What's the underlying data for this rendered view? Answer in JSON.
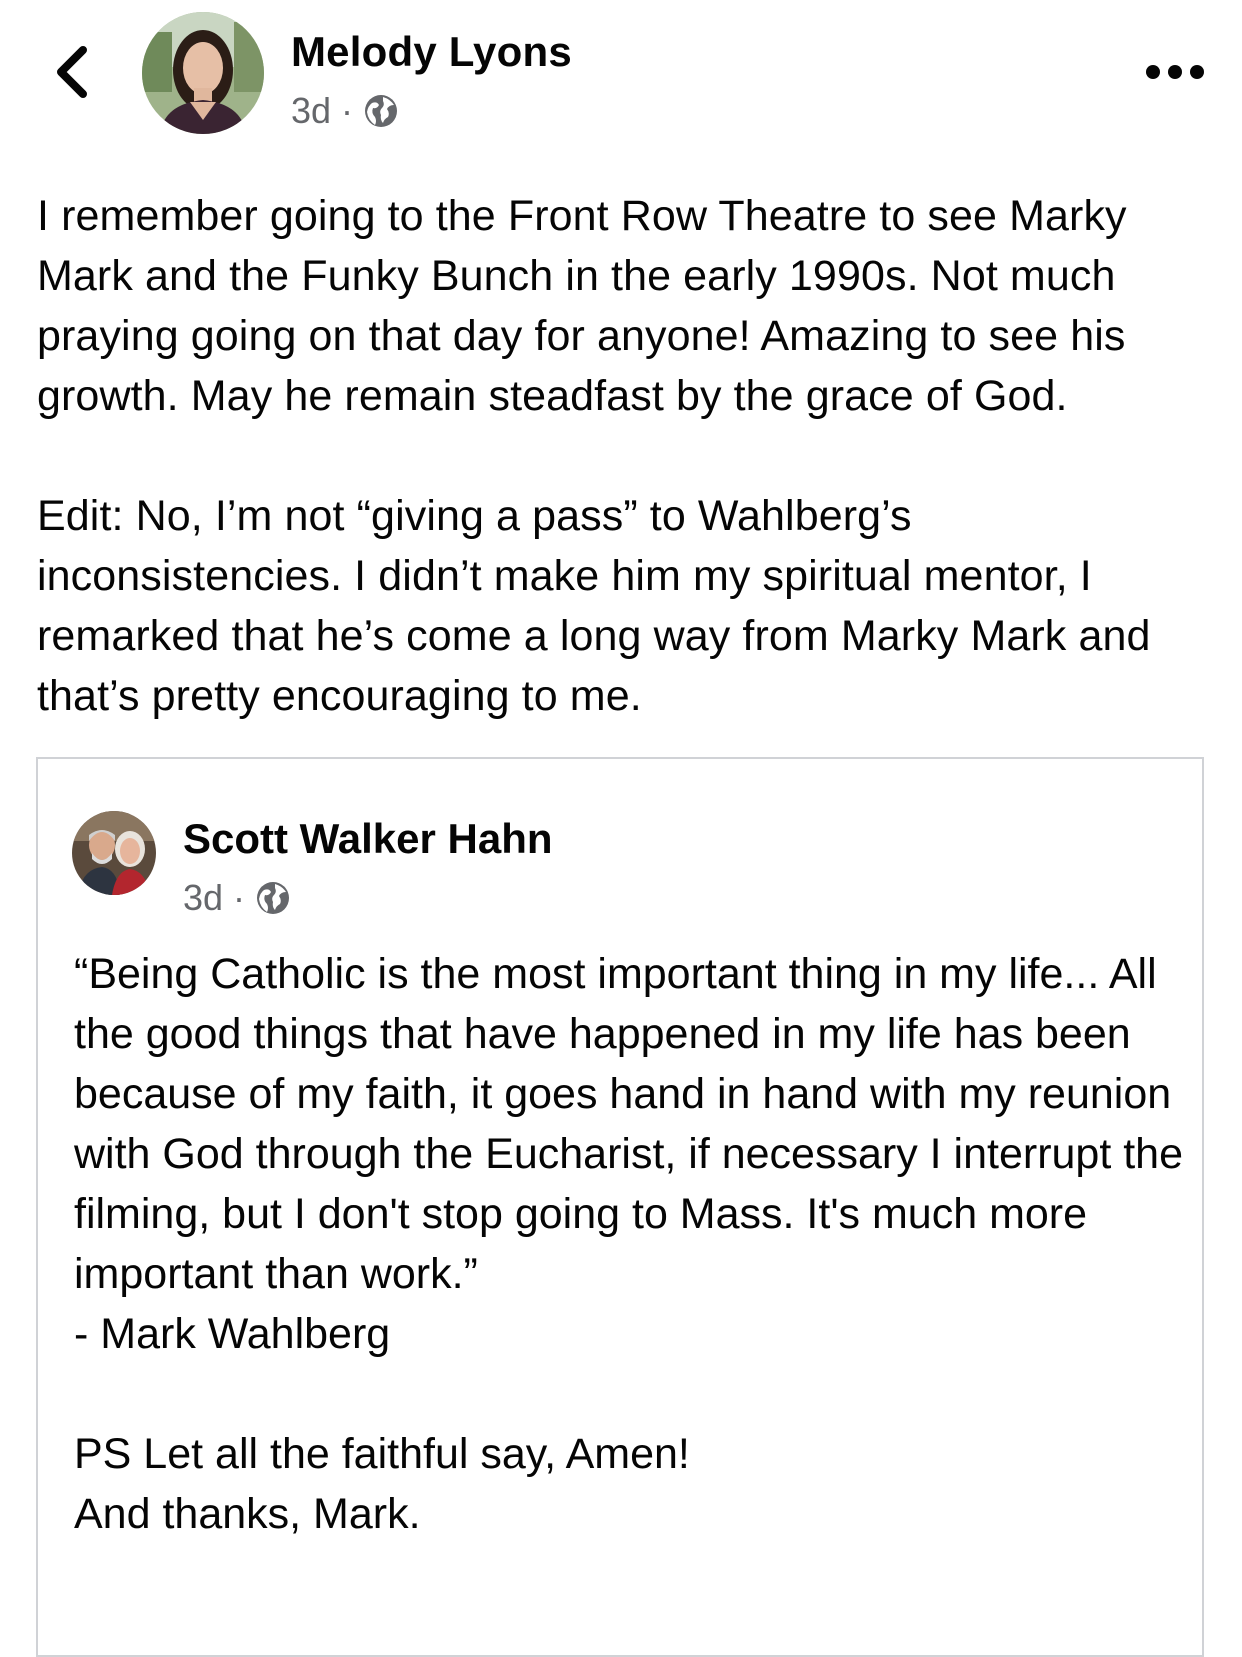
{
  "header": {
    "author_name": "Melody Lyons",
    "time": "3d",
    "separator": "·",
    "privacy_icon": "globe-icon",
    "back_icon": "chevron-left-icon",
    "more_icon": "more-horizontal-icon"
  },
  "post": {
    "paragraph_1": "I remember going to the Front Row Theatre to see Marky Mark and the Funky Bunch in the early 1990s. Not much praying going on that day for anyone! Amazing to see his growth. May he remain steadfast by the grace of God.",
    "paragraph_2": "Edit: No, I’m not “giving a pass” to Wahlberg’s inconsistencies. I didn’t make him my spiritual mentor, I remarked that he’s come a long way from Marky Mark and that’s pretty encouraging to me."
  },
  "shared_post": {
    "author_name": "Scott Walker Hahn",
    "time": "3d",
    "separator": "·",
    "privacy_icon": "globe-icon",
    "paragraph_1": "“Being Catholic is the most important thing in my life... All the good things that have happened in my life has been because of my faith, it goes hand in hand with my reunion with God through the Eucharist, if necessary I interrupt the filming, but I don't stop going to Mass. It's much more important than work.”\n- Mark Wahlberg",
    "paragraph_2": "PS Let all the faithful say, Amen!\nAnd thanks, Mark."
  },
  "colors": {
    "text": "#050505",
    "secondary_text": "#65676b",
    "card_border": "#d0d2d6"
  }
}
